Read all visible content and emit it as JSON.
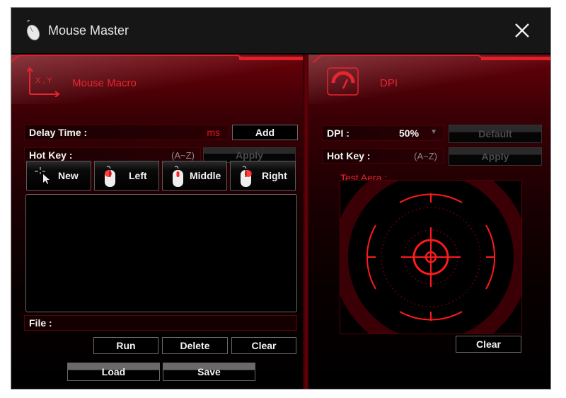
{
  "window": {
    "title": "Mouse Master",
    "icons": {
      "app": "mouse-icon",
      "close": "close-icon"
    }
  },
  "colors": {
    "accent": "#e82430",
    "background": "#000000",
    "titlebar": "#161616"
  },
  "macro": {
    "section_title": "Mouse Macro",
    "section_icon": "xy-axis-icon",
    "section_icon_label": "X , Y",
    "delay_label": "Delay Time :",
    "delay_value": "",
    "delay_unit": "ms",
    "add_button": "Add",
    "hotkey_label": "Hot Key :",
    "hotkey_hint": "(A~Z)",
    "apply_button": "Apply",
    "mouse_buttons": [
      {
        "label": "New",
        "icon": "crosshair-cursor-icon"
      },
      {
        "label": "Left",
        "icon": "mouse-left-icon"
      },
      {
        "label": "Middle",
        "icon": "mouse-middle-icon"
      },
      {
        "label": "Right",
        "icon": "mouse-right-icon"
      }
    ],
    "macro_list": [],
    "file_label": "File :",
    "file_value": "",
    "run_button": "Run",
    "delete_button": "Delete",
    "clear_button": "Clear",
    "load_button": "Load",
    "save_button": "Save"
  },
  "dpi": {
    "section_title": "DPI",
    "section_icon": "speedometer-icon",
    "dpi_label": "DPI :",
    "dpi_value": "50%",
    "default_button": "Default",
    "hotkey_label": "Hot Key :",
    "hotkey_hint": "(A~Z)",
    "apply_button": "Apply",
    "test_area_label": "Test Aera :",
    "test_area_icon": "crosshair-target-icon",
    "clear_button": "Clear"
  }
}
